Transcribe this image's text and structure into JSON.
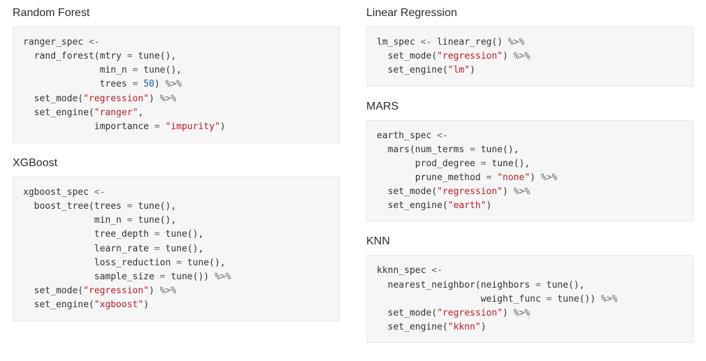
{
  "left": {
    "rf": {
      "title": "Random Forest",
      "code": [
        {
          "t": "ranger_spec "
        },
        {
          "t": "<-",
          "c": "o"
        },
        {
          "nl": true
        },
        {
          "t": "  rand_forest(mtry "
        },
        {
          "t": "=",
          "c": "o"
        },
        {
          "t": " tune(),"
        },
        {
          "nl": true
        },
        {
          "t": "              min_n "
        },
        {
          "t": "=",
          "c": "o"
        },
        {
          "t": " tune(),"
        },
        {
          "nl": true
        },
        {
          "t": "              trees "
        },
        {
          "t": "=",
          "c": "o"
        },
        {
          "t": " "
        },
        {
          "t": "50",
          "c": "n"
        },
        {
          "t": ") "
        },
        {
          "t": "%>%",
          "c": "o"
        },
        {
          "nl": true
        },
        {
          "t": "  set_mode("
        },
        {
          "t": "\"regression\"",
          "c": "s"
        },
        {
          "t": ") "
        },
        {
          "t": "%>%",
          "c": "o"
        },
        {
          "nl": true
        },
        {
          "t": "  set_engine("
        },
        {
          "t": "\"ranger\"",
          "c": "s"
        },
        {
          "t": ","
        },
        {
          "nl": true
        },
        {
          "t": "             importance "
        },
        {
          "t": "=",
          "c": "o"
        },
        {
          "t": " "
        },
        {
          "t": "\"impurity\"",
          "c": "s"
        },
        {
          "t": ")"
        }
      ]
    },
    "xgb": {
      "title": "XGBoost",
      "code": [
        {
          "t": "xgboost_spec "
        },
        {
          "t": "<-",
          "c": "o"
        },
        {
          "nl": true
        },
        {
          "t": "  boost_tree(trees "
        },
        {
          "t": "=",
          "c": "o"
        },
        {
          "t": " tune(),"
        },
        {
          "nl": true
        },
        {
          "t": "             min_n "
        },
        {
          "t": "=",
          "c": "o"
        },
        {
          "t": " tune(),"
        },
        {
          "nl": true
        },
        {
          "t": "             tree_depth "
        },
        {
          "t": "=",
          "c": "o"
        },
        {
          "t": " tune(),"
        },
        {
          "nl": true
        },
        {
          "t": "             learn_rate "
        },
        {
          "t": "=",
          "c": "o"
        },
        {
          "t": " tune(),"
        },
        {
          "nl": true
        },
        {
          "t": "             loss_reduction "
        },
        {
          "t": "=",
          "c": "o"
        },
        {
          "t": " tune(),"
        },
        {
          "nl": true
        },
        {
          "t": "             sample_size "
        },
        {
          "t": "=",
          "c": "o"
        },
        {
          "t": " tune()) "
        },
        {
          "t": "%>%",
          "c": "o"
        },
        {
          "nl": true
        },
        {
          "t": "  set_mode("
        },
        {
          "t": "\"regression\"",
          "c": "s"
        },
        {
          "t": ") "
        },
        {
          "t": "%>%",
          "c": "o"
        },
        {
          "nl": true
        },
        {
          "t": "  set_engine("
        },
        {
          "t": "\"xgboost\"",
          "c": "s"
        },
        {
          "t": ")"
        }
      ]
    }
  },
  "right": {
    "lm": {
      "title": "Linear Regression",
      "code": [
        {
          "t": "lm_spec "
        },
        {
          "t": "<-",
          "c": "o"
        },
        {
          "t": " linear_reg() "
        },
        {
          "t": "%>%",
          "c": "o"
        },
        {
          "nl": true
        },
        {
          "t": "  set_mode("
        },
        {
          "t": "\"regression\"",
          "c": "s"
        },
        {
          "t": ") "
        },
        {
          "t": "%>%",
          "c": "o"
        },
        {
          "nl": true
        },
        {
          "t": "  set_engine("
        },
        {
          "t": "\"lm\"",
          "c": "s"
        },
        {
          "t": ")"
        }
      ]
    },
    "mars": {
      "title": "MARS",
      "code": [
        {
          "t": "earth_spec "
        },
        {
          "t": "<-",
          "c": "o"
        },
        {
          "nl": true
        },
        {
          "t": "  mars(num_terms "
        },
        {
          "t": "=",
          "c": "o"
        },
        {
          "t": " tune(),"
        },
        {
          "nl": true
        },
        {
          "t": "       prod_degree "
        },
        {
          "t": "=",
          "c": "o"
        },
        {
          "t": " tune(),"
        },
        {
          "nl": true
        },
        {
          "t": "       prune_method "
        },
        {
          "t": "=",
          "c": "o"
        },
        {
          "t": " "
        },
        {
          "t": "\"none\"",
          "c": "s"
        },
        {
          "t": ") "
        },
        {
          "t": "%>%",
          "c": "o"
        },
        {
          "nl": true
        },
        {
          "t": "  set_mode("
        },
        {
          "t": "\"regression\"",
          "c": "s"
        },
        {
          "t": ") "
        },
        {
          "t": "%>%",
          "c": "o"
        },
        {
          "nl": true
        },
        {
          "t": "  set_engine("
        },
        {
          "t": "\"earth\"",
          "c": "s"
        },
        {
          "t": ")"
        }
      ]
    },
    "knn": {
      "title": "KNN",
      "code": [
        {
          "t": "kknn_spec "
        },
        {
          "t": "<-",
          "c": "o"
        },
        {
          "nl": true
        },
        {
          "t": "  nearest_neighbor(neighbors "
        },
        {
          "t": "=",
          "c": "o"
        },
        {
          "t": " tune(),"
        },
        {
          "nl": true
        },
        {
          "t": "                   weight_func "
        },
        {
          "t": "=",
          "c": "o"
        },
        {
          "t": " tune()) "
        },
        {
          "t": "%>%",
          "c": "o"
        },
        {
          "nl": true
        },
        {
          "t": "  set_mode("
        },
        {
          "t": "\"regression\"",
          "c": "s"
        },
        {
          "t": ") "
        },
        {
          "t": "%>%",
          "c": "o"
        },
        {
          "nl": true
        },
        {
          "t": "  set_engine("
        },
        {
          "t": "\"kknn\"",
          "c": "s"
        },
        {
          "t": ")"
        }
      ]
    }
  }
}
